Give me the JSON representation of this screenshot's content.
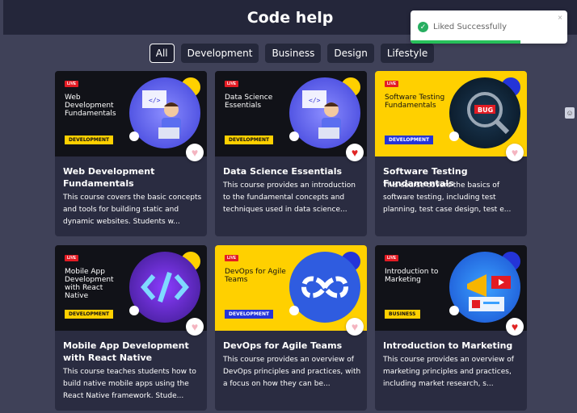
{
  "app": {
    "title": "Code help"
  },
  "filters": [
    "All",
    "Development",
    "Business",
    "Design",
    "Lifestyle"
  ],
  "active_filter": "All",
  "toast": {
    "message": "Liked Successfully",
    "close": "×",
    "progress": 0.7
  },
  "courses": [
    {
      "live": "LIVE",
      "thumb_title": "Web Development Fundamentals",
      "tag": "DEVELOPMENT",
      "title": "Web Development Fundamentals",
      "desc": "This course covers the basic concepts and tools for building static and dynamic websites. Students w...",
      "liked": false
    },
    {
      "live": "LIVE",
      "thumb_title": "Data Science Essentials",
      "tag": "DEVELOPMENT",
      "title": "Data Science Essentials",
      "desc": "This course provides an introduction to the fundamental concepts and techniques used in data science...",
      "liked": true
    },
    {
      "live": "LIVE",
      "thumb_title": "Software Testing Fundamentals",
      "tag": "DEVELOPMENT",
      "title": "Software Testing Fundamentals",
      "desc": "This course covers the basics of software testing, including test planning, test case design, test e...",
      "liked": false
    },
    {
      "live": "LIVE",
      "thumb_title": "Mobile App Development with React Native",
      "tag": "DEVELOPMENT",
      "title": "Mobile App Development with React Native",
      "desc": "This course teaches students how to build native mobile apps using the React Native framework. Stude...",
      "liked": false
    },
    {
      "live": "LIVE",
      "thumb_title": "DevOps for Agile Teams",
      "tag": "DEVELOPMENT",
      "title": "DevOps for Agile Teams",
      "desc": "This course provides an overview of DevOps principles and practices, with a focus on how they can be...",
      "liked": false
    },
    {
      "live": "LIVE",
      "thumb_title": "Introduction to Marketing",
      "tag": "BUSINESS",
      "title": "Introduction to Marketing",
      "desc": "This course provides an overview of marketing principles and practices, including market research, s...",
      "liked": true
    }
  ],
  "colors": {
    "background": "#3f4158",
    "header": "#24263a",
    "card": "#2a2c41",
    "accent_yellow": "#ffd000",
    "accent_blue": "#2434d8",
    "heart_liked": "#e02424",
    "toast_success": "#27ae60"
  }
}
